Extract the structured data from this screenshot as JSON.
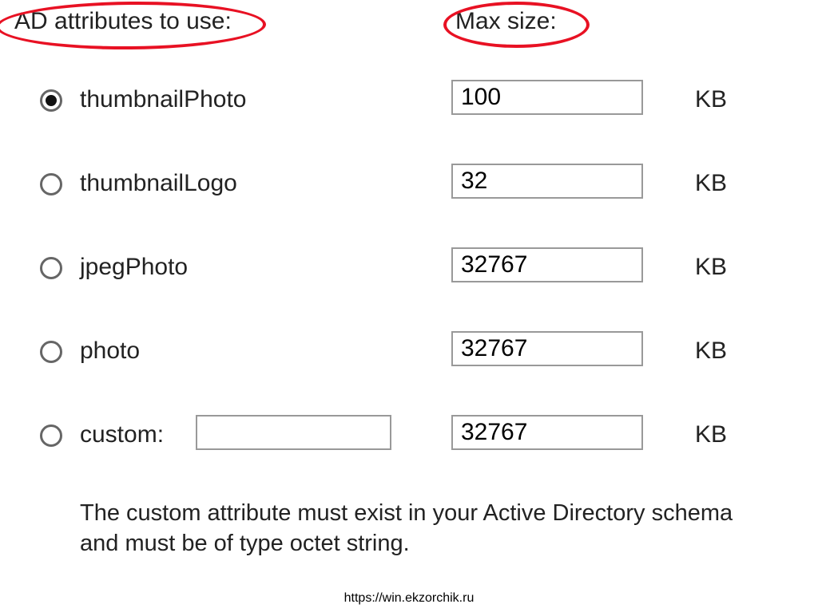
{
  "header": {
    "attributes_label": "AD attributes to use:",
    "maxsize_label": "Max size:"
  },
  "unit": "KB",
  "options": [
    {
      "label": "thumbnailPhoto",
      "size": "100",
      "selected": true,
      "custom": false
    },
    {
      "label": "thumbnailLogo",
      "size": "32",
      "selected": false,
      "custom": false
    },
    {
      "label": "jpegPhoto",
      "size": "32767",
      "selected": false,
      "custom": false
    },
    {
      "label": "photo",
      "size": "32767",
      "selected": false,
      "custom": false
    },
    {
      "label": "custom:",
      "size": "32767",
      "selected": false,
      "custom": true,
      "custom_value": ""
    }
  ],
  "note": "The custom attribute must exist in your Active Directory schema and must be of type octet string.",
  "footer": "https://win.ekzorchik.ru"
}
